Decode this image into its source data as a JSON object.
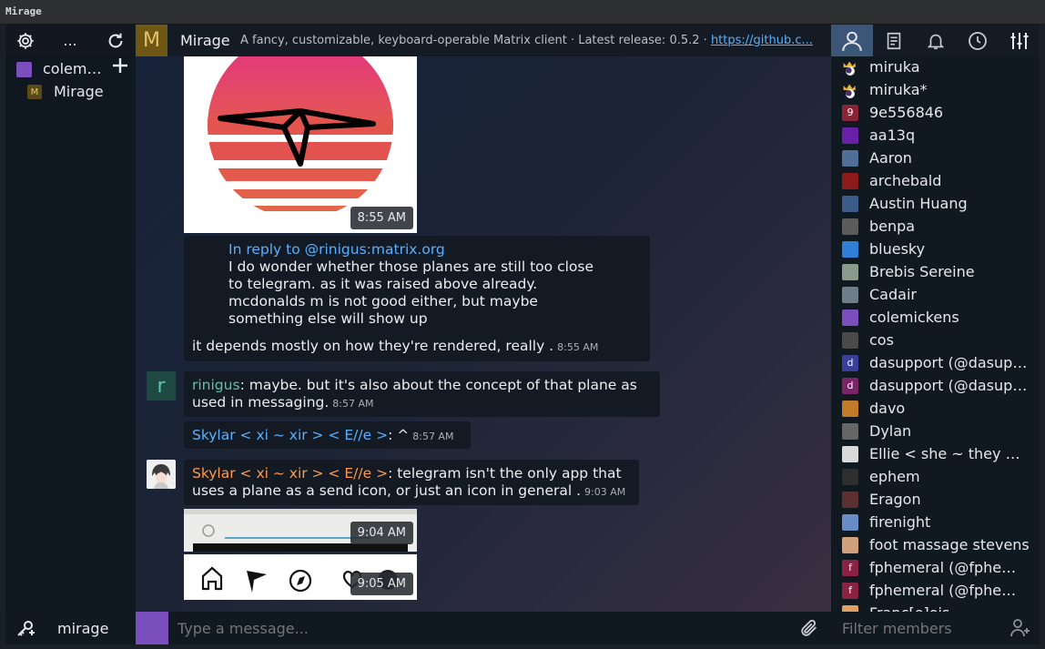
{
  "window": {
    "title": "Mirage"
  },
  "toolbar": {
    "more_label": "..."
  },
  "sidebar": {
    "account": {
      "name": "colem…",
      "color": "#7a4fbd"
    },
    "rooms": [
      {
        "name": "Mirage",
        "avatar_letter": "M"
      }
    ],
    "bottom": {
      "account_name": "mirage"
    }
  },
  "room": {
    "avatar_letter": "M",
    "name": "Mirage",
    "topic": "A fancy, customizable, keyboard-operable Matrix client · Latest release: 0.5.2 ·",
    "topic_link": "https://github.c..."
  },
  "messages": [
    {
      "type": "image",
      "time": "8:55 AM"
    },
    {
      "type": "reply",
      "reply_header": "In reply to @rinigus:matrix.org",
      "quoted_lines": [
        "I do wonder whether those planes are still too close",
        "to telegram. as it was raised above already.",
        "mcdonalds m is not good either, but maybe",
        "something else will show up"
      ],
      "body": "it depends mostly on how they're rendered, really .",
      "time": "8:55 AM"
    },
    {
      "type": "text",
      "avatar_letter": "r",
      "sender": "rinigus",
      "lines": [
        "maybe. but it's also about the concept of that plane as",
        "used in messaging."
      ],
      "time": "8:57 AM"
    },
    {
      "type": "text",
      "sender": "Skylar < xi ~ xir > < E//e >",
      "body": "^",
      "time": "8:57 AM"
    },
    {
      "type": "text",
      "sender": "Skylar < xi ~ xir > < E//e >",
      "lines": [
        "telegram isn't the only app that",
        "uses a plane as a send icon, or just an icon in general ."
      ],
      "time": "9:03 AM"
    },
    {
      "type": "image",
      "time": "9:04 AM"
    },
    {
      "type": "image",
      "time": "9:05 AM"
    }
  ],
  "members": [
    {
      "name": "miruka",
      "color": "#ffffff",
      "crown": true
    },
    {
      "name": "miruka*",
      "color": "#ffffff",
      "crown": true
    },
    {
      "name": "9e556846",
      "letter": "9",
      "color": "#8a2335"
    },
    {
      "name": "aa13q",
      "color": "#6a1fa8"
    },
    {
      "name": "Aaron",
      "color": "#4f6f96"
    },
    {
      "name": "archebald",
      "color": "#8d1b1b"
    },
    {
      "name": "Austin Huang",
      "color": "#3c5c8a"
    },
    {
      "name": "benpa",
      "color": "#5b5b5b"
    },
    {
      "name": "bluesky",
      "color": "#2f7fd6"
    },
    {
      "name": "Brebis Sereine",
      "color": "#8a9a8a"
    },
    {
      "name": "Cadair",
      "color": "#6d7e88"
    },
    {
      "name": "colemickens",
      "color": "#7a4fbd"
    },
    {
      "name": "cos",
      "color": "#4a4a4a"
    },
    {
      "name": "dasupport (@dasup…",
      "letter": "d",
      "color": "#3b3f9a"
    },
    {
      "name": "dasupport (@dasup…",
      "letter": "d",
      "color": "#7a2468"
    },
    {
      "name": "davo",
      "color": "#c07a2a"
    },
    {
      "name": "Dylan",
      "color": "#666666"
    },
    {
      "name": "Ellie < she ~ they …",
      "color": "#d9d9d9"
    },
    {
      "name": "ephem",
      "color": "#2e2e2e"
    },
    {
      "name": "Eragon",
      "color": "#5a3030"
    },
    {
      "name": "firenight",
      "color": "#6a8cc4"
    },
    {
      "name": "foot massage stevens",
      "color": "#d1a07d"
    },
    {
      "name": "fphemeral (@fphe…",
      "letter": "f",
      "color": "#8a2343"
    },
    {
      "name": "fphemeral (@fphe…",
      "letter": "f",
      "color": "#8a2343"
    },
    {
      "name": "Franc[e]ois",
      "color": "#e0a060"
    }
  ],
  "composer": {
    "placeholder": "Type a message...",
    "avatar_color": "#7a4fbd"
  },
  "filter": {
    "placeholder": "Filter members"
  },
  "colors": {
    "accent_tab": "#3c5678",
    "sender_rinigus": "#58c7a8",
    "sender_skylar_blue": "#5ab0ff",
    "sender_skylar_orange": "#ff9a4a",
    "reply_header": "#5ab0ff"
  }
}
